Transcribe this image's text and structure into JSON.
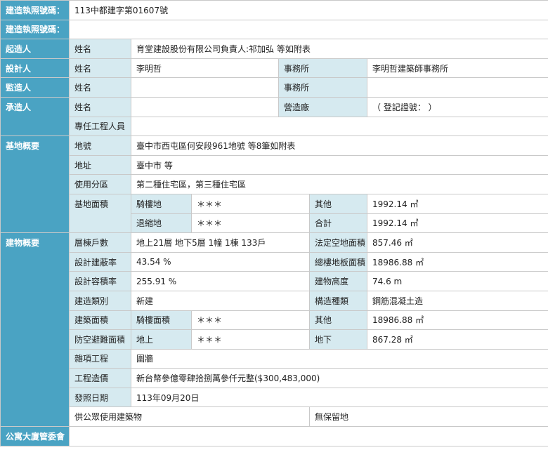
{
  "permit": {
    "label1": "建造執照號碼：",
    "value1": "113中都建字第01607號",
    "label2": "建造執照號碼：",
    "value2": ""
  },
  "applicant": {
    "section": "起造人",
    "name_label": "姓名",
    "name_value": "育堂建設股份有限公司負責人:祁加弘 等如附表"
  },
  "designer": {
    "section": "設計人",
    "name_label": "姓名",
    "name_value": "李明哲",
    "office_label": "事務所",
    "office_value": "李明哲建築師事務所"
  },
  "supervisor": {
    "section": "監造人",
    "name_label": "姓名",
    "name_value": "",
    "office_label": "事務所",
    "office_value": ""
  },
  "contractor": {
    "section": "承造人",
    "name_label": "姓名",
    "name_value": "",
    "factory_label": "營造廠",
    "factory_value": "（ 登記證號： ）",
    "engineer_label": "專任工程人員",
    "engineer_value": ""
  },
  "site": {
    "section": "基地概要",
    "lot_label": "地號",
    "lot_value": "臺中市西屯區何安段961地號 等8筆如附表",
    "address_label": "地址",
    "address_value": "臺中市 等",
    "zoning_label": "使用分區",
    "zoning_value": "第二種住宅區，第三種住宅區",
    "area_label": "基地面積",
    "arcade_label": "騎樓地",
    "arcade_value": "＊＊＊",
    "other_label": "其他",
    "other_value": "1992.14 ㎡",
    "setback_label": "退縮地",
    "setback_value": "＊＊＊",
    "total_label": "合計",
    "total_value": "1992.14 ㎡"
  },
  "building": {
    "section": "建物概要",
    "floors_label": "層棟戶數",
    "floors_value": "地上21層 地下5層 1幢 1棟 133戶",
    "open_space_label": "法定空地面積",
    "open_space_value": "857.46 ㎡",
    "coverage_label": "設計建蔽率",
    "coverage_value": "43.54 %",
    "floor_area_label": "總樓地板面積",
    "floor_area_value": "18986.88 ㎡",
    "far_label": "設計容積率",
    "far_value": "255.91 %",
    "height_label": "建物高度",
    "height_value": "74.6 m",
    "build_type_label": "建造類別",
    "build_type_value": "新建",
    "structure_label": "構造種類",
    "structure_value": "鋼筋混凝土造",
    "build_area_label": "建築面積",
    "arcade_area_label": "騎樓面積",
    "arcade_area_value": "＊＊＊",
    "build_other_label": "其他",
    "build_other_value": "18986.88 ㎡",
    "shelter_label": "防空避難面積",
    "above_label": "地上",
    "above_value": "＊＊＊",
    "below_label": "地下",
    "below_value": "867.28 ㎡",
    "misc_label": "雜項工程",
    "misc_value": "圍牆",
    "cost_label": "工程造價",
    "cost_value": "新台幣參億零肆拾捌萬參仟元整($300,483,000)",
    "date_label": "發照日期",
    "date_value": "113年09月20日",
    "public_use": "供公眾使用建築物",
    "no_reserve": "無保留地"
  },
  "committee": {
    "section": "公寓大廈管委會",
    "value": ""
  }
}
